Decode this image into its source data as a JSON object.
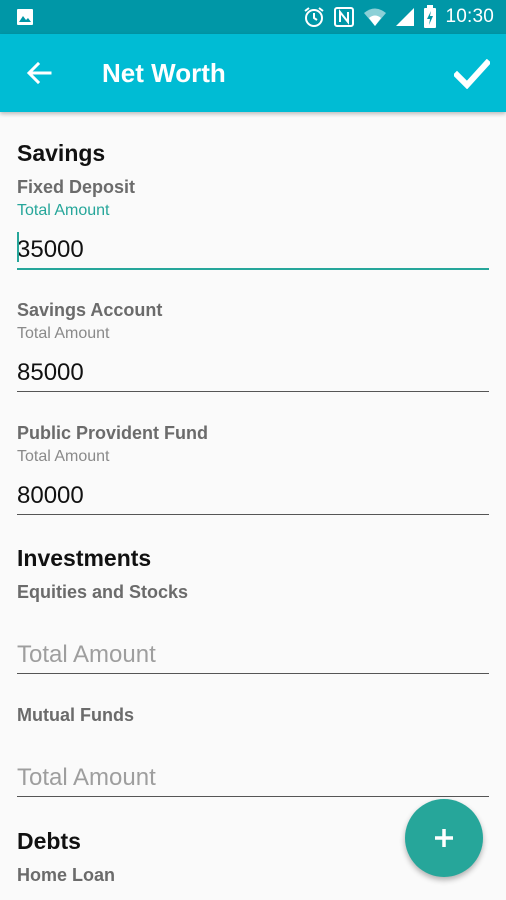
{
  "status_bar": {
    "time": "10:30",
    "icons": [
      "image-icon",
      "alarm-icon",
      "nfc-icon",
      "wifi-icon",
      "signal-icon",
      "battery-charging-icon"
    ]
  },
  "app_bar": {
    "title": "Net Worth",
    "back_icon": "arrow-left-icon",
    "done_icon": "check-icon"
  },
  "colors": {
    "status_bar": "#0097a7",
    "app_bar": "#00bcd4",
    "accent": "#26a69a",
    "background": "#fafafa"
  },
  "sections": [
    {
      "title": "Savings",
      "fields": [
        {
          "label": "Fixed Deposit",
          "hint": "Total Amount",
          "value": "35000",
          "focused": true
        },
        {
          "label": "Savings Account",
          "hint": "Total Amount",
          "value": "85000"
        },
        {
          "label": "Public Provident Fund",
          "hint": "Total Amount",
          "value": "80000"
        }
      ]
    },
    {
      "title": "Investments",
      "fields": [
        {
          "label": "Equities and Stocks",
          "placeholder": "Total Amount",
          "value": ""
        },
        {
          "label": "Mutual Funds",
          "placeholder": "Total Amount",
          "value": ""
        }
      ]
    },
    {
      "title": "Debts",
      "fields": [
        {
          "label": "Home Loan"
        }
      ]
    }
  ],
  "fab": {
    "icon": "plus-icon"
  }
}
